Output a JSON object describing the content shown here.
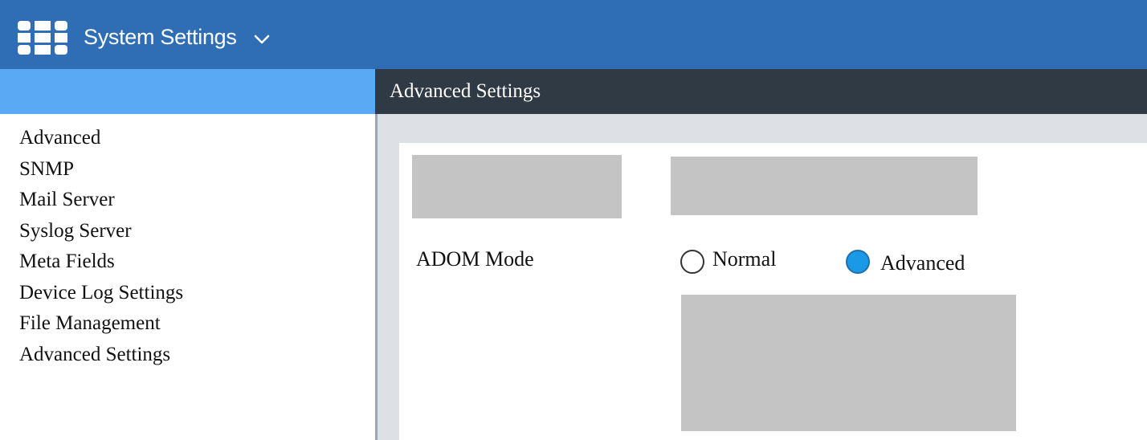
{
  "topbar": {
    "logo_icon": "fortinet-grid-icon",
    "app_title": "System Settings",
    "dropdown_icon": "chevron-down-icon",
    "color": "#2f6eb5"
  },
  "sidebar": {
    "items": [
      {
        "label": "Advanced"
      },
      {
        "label": "SNMP"
      },
      {
        "label": "Mail Server"
      },
      {
        "label": "Syslog Server"
      },
      {
        "label": "Meta Fields"
      },
      {
        "label": "Device Log Settings"
      },
      {
        "label": "File Management"
      },
      {
        "label": "Advanced Settings"
      }
    ],
    "header_color": "#5aa9f5"
  },
  "main": {
    "title": "Advanced Settings",
    "header_color": "#2f3a44",
    "adom_mode": {
      "label": "ADOM Mode",
      "options": [
        {
          "label": "Normal",
          "selected": false
        },
        {
          "label": "Advanced",
          "selected": true
        }
      ],
      "selected_color": "#1a9ae6"
    }
  }
}
